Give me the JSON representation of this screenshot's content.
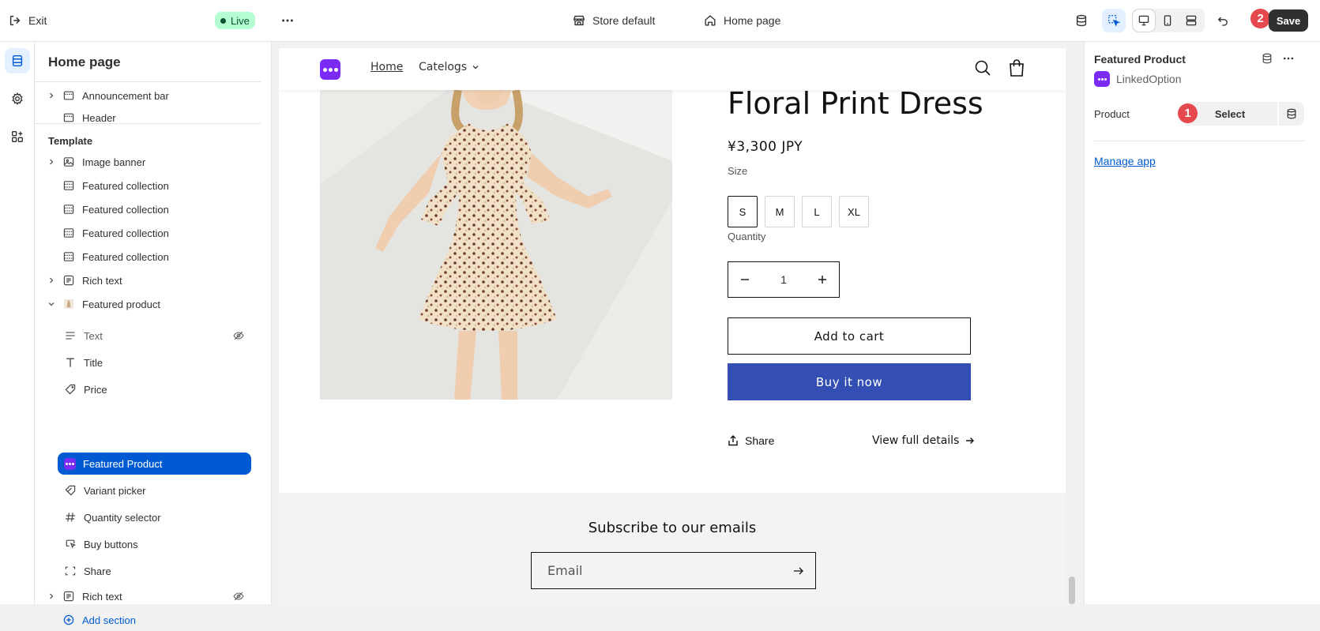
{
  "topbar": {
    "exit_label": "Exit",
    "live_label": "Live",
    "theme_label": "Store default",
    "page_label": "Home page",
    "save_label": "Save",
    "badge_select": "1",
    "badge_save": "2"
  },
  "sidebar": {
    "title": "Home page",
    "header_group": [
      {
        "label": "Announcement bar",
        "icon": "layout-section-icon",
        "expandable": true
      },
      {
        "label": "Header",
        "icon": "layout-section-icon",
        "expandable": false
      }
    ],
    "template_heading": "Template",
    "sections": [
      {
        "label": "Image banner",
        "icon": "image-icon",
        "expandable": true
      },
      {
        "label": "Featured collection",
        "icon": "collection-icon"
      },
      {
        "label": "Featured collection",
        "icon": "collection-icon"
      },
      {
        "label": "Featured collection",
        "icon": "collection-icon"
      },
      {
        "label": "Featured collection",
        "icon": "collection-icon"
      },
      {
        "label": "Rich text",
        "icon": "text-block-icon",
        "expandable": true
      },
      {
        "label": "Featured product",
        "icon": "product-thumbnail-icon",
        "expanded": true
      }
    ],
    "blocks": [
      {
        "label": "Text",
        "icon": "text-lines-icon",
        "hidden": true
      },
      {
        "label": "Title",
        "icon": "title-icon"
      },
      {
        "label": "Price",
        "icon": "price-tag-icon"
      },
      {
        "label": "Featured Product",
        "icon": "app-block-icon",
        "selected": true
      },
      {
        "label": "Variant picker",
        "icon": "variant-icon"
      },
      {
        "label": "Quantity selector",
        "icon": "hash-icon"
      },
      {
        "label": "Buy buttons",
        "icon": "buy-button-icon"
      },
      {
        "label": "Share",
        "icon": "share-frame-icon"
      }
    ],
    "after_sections": [
      {
        "label": "Rich text",
        "icon": "text-block-icon",
        "expandable": true,
        "hidden": true
      }
    ],
    "add_section_label": "Add section"
  },
  "preview": {
    "nav": {
      "home": "Home",
      "catalog": "Catelogs"
    },
    "product": {
      "title": "Floral Print Dress",
      "price": "¥3,300 JPY",
      "size_label": "Size",
      "sizes": [
        "S",
        "M",
        "L",
        "XL"
      ],
      "selected_size": "S",
      "quantity_label": "Quantity",
      "quantity": "1",
      "add_to_cart": "Add to cart",
      "buy_now": "Buy it now",
      "share": "Share",
      "view_details": "View full details"
    },
    "newsletter": {
      "title": "Subscribe to our emails",
      "email_placeholder": "Email"
    },
    "colors": {
      "buy_button": "#334fb4",
      "logo": "#7a2bf5"
    }
  },
  "inspector": {
    "title": "Featured Product",
    "app_name": "LinkedOption",
    "product_label": "Product",
    "select_label": "Select",
    "manage_app": "Manage app"
  },
  "colors": {
    "accent": "#005bd3",
    "live_bg": "#b4fed2",
    "badge": "#e5484d"
  }
}
